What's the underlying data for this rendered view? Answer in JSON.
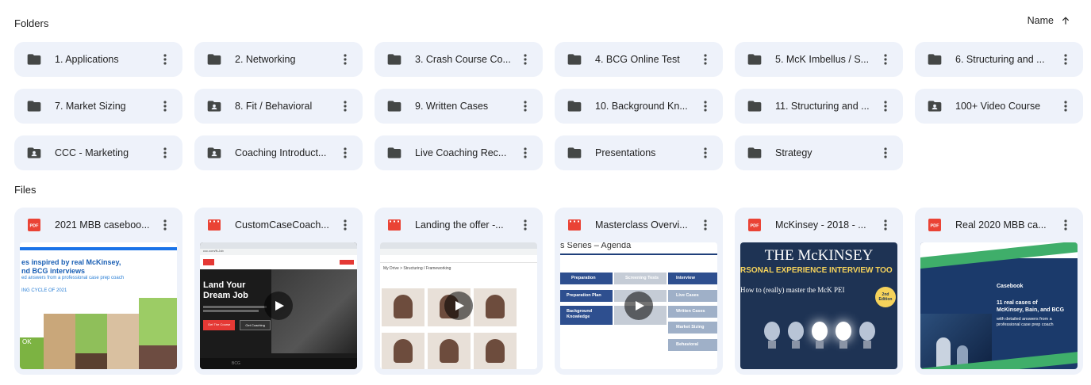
{
  "folders_title": "Folders",
  "files_title": "Files",
  "sort": {
    "label": "Name",
    "icon": "arrow-up-icon"
  },
  "folders": [
    {
      "name": "1. Applications",
      "icon": "folder"
    },
    {
      "name": "2. Networking",
      "icon": "folder"
    },
    {
      "name": "3. Crash Course Co...",
      "icon": "folder"
    },
    {
      "name": "4. BCG Online Test",
      "icon": "folder"
    },
    {
      "name": "5. McK Imbellus / S...",
      "icon": "folder"
    },
    {
      "name": "6. Structuring and ...",
      "icon": "folder"
    },
    {
      "name": "7. Market Sizing",
      "icon": "folder"
    },
    {
      "name": "8. Fit / Behavioral",
      "icon": "shared-folder"
    },
    {
      "name": "9. Written Cases",
      "icon": "folder"
    },
    {
      "name": "10. Background Kn...",
      "icon": "folder"
    },
    {
      "name": "11. Structuring and ...",
      "icon": "folder"
    },
    {
      "name": "100+ Video Course",
      "icon": "shared-folder"
    },
    {
      "name": "CCC - Marketing",
      "icon": "shared-folder"
    },
    {
      "name": "Coaching Introduct...",
      "icon": "shared-folder"
    },
    {
      "name": "Live Coaching Rec...",
      "icon": "folder"
    },
    {
      "name": "Presentations",
      "icon": "folder"
    },
    {
      "name": "Strategy",
      "icon": "folder"
    }
  ],
  "files": [
    {
      "name": "2021 MBB caseboo...",
      "type": "pdf",
      "thumb": {
        "kind": "casebook",
        "line1": "es inspired by real McKinsey,",
        "line2": "nd BCG interviews",
        "line3": "ed answers from a professional case prep coach",
        "line4": "ING CYCLE OF 2021",
        "badge": "OK"
      }
    },
    {
      "name": "CustomCaseCoach...",
      "type": "video",
      "thumb": {
        "kind": "website",
        "headline1": "Land Your",
        "headline2": "Dream Job",
        "url": "ccc.com/ft-Job",
        "btn1": "Get The Course",
        "btn2": "Get Coaching",
        "logo": "BCG"
      }
    },
    {
      "name": "Landing the offer -...",
      "type": "video",
      "thumb": {
        "kind": "drive",
        "path": "My Drive > Structuring / Frameworking"
      }
    },
    {
      "name": "Masterclass Overvi...",
      "type": "video",
      "thumb": {
        "kind": "agenda",
        "title": "s Series – Agenda",
        "left": [
          "Preparation",
          "Preparation Plan",
          "Background Knowledge"
        ],
        "mid": [
          "Screening Tests",
          "",
          ""
        ],
        "right": [
          "Interview",
          "Live Cases",
          "Written Cases",
          "Market Sizing",
          "Behavioral"
        ]
      }
    },
    {
      "name": "McKinsey - 2018 - ...",
      "type": "pdf",
      "thumb": {
        "kind": "book",
        "title": "THE McKINSEY",
        "subtitle": "RSONAL EXPERIENCE INTERVIEW TOO",
        "tagline": "How to (really) master the McK PEI",
        "edition": "2nd Edition"
      }
    },
    {
      "name": "Real 2020 MBB ca...",
      "type": "pdf",
      "thumb": {
        "kind": "casebook2",
        "label": "Casebook",
        "line1": "11 real cases of",
        "line2": "McKinsey, Bain, and BCG",
        "line3": "with detailed answers from a",
        "line4": "professional case prep coach"
      }
    }
  ],
  "colors": {
    "card_bg": "#eef2fa",
    "folder_icon": "#444746",
    "pdf_red": "#ea4335",
    "video_red": "#ea4335",
    "accent_blue": "#1a73e8"
  }
}
